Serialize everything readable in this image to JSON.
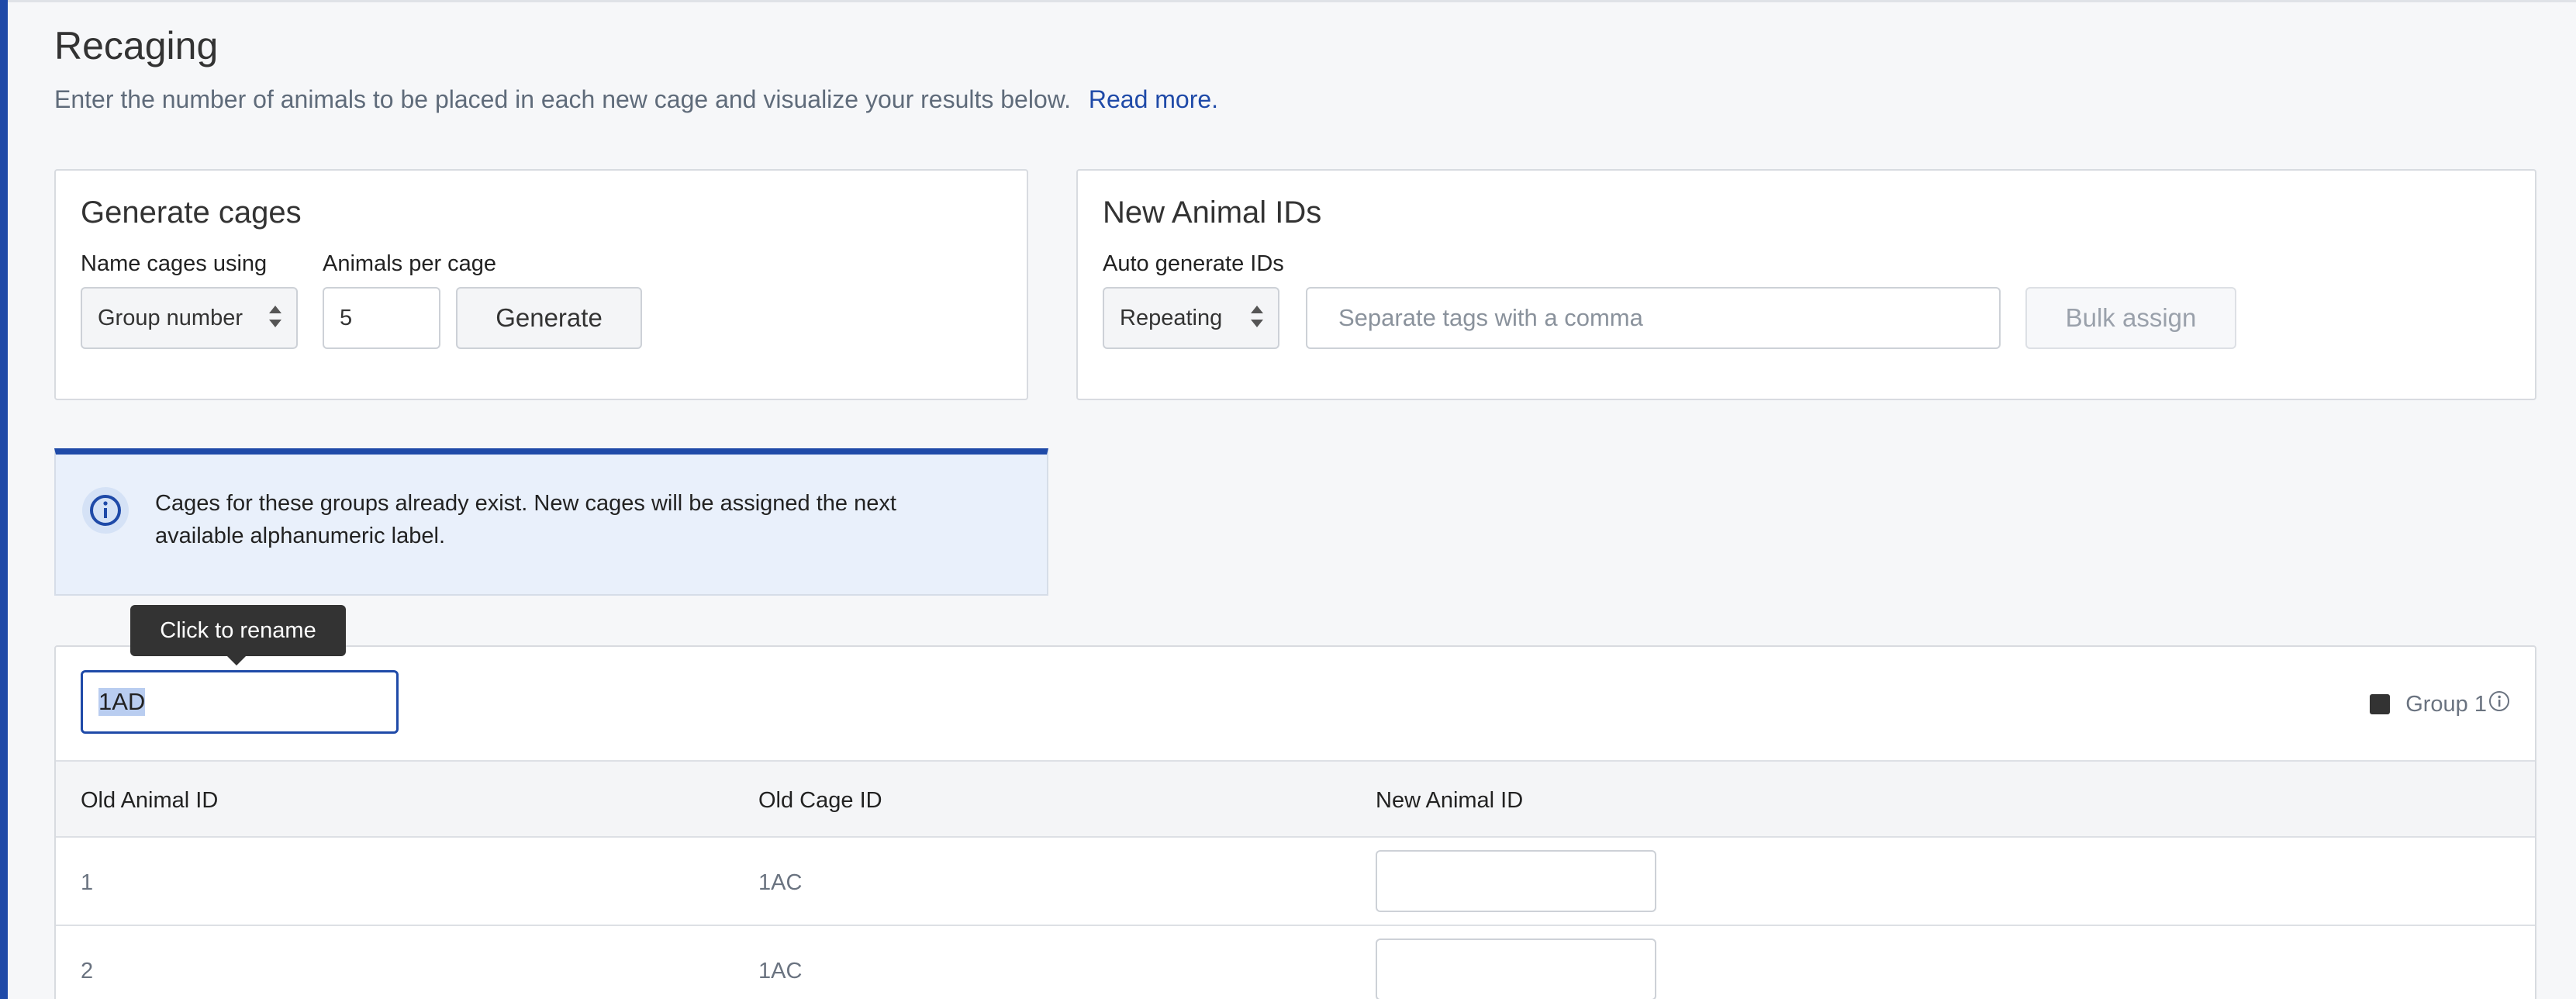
{
  "page": {
    "title": "Recaging",
    "subtitle": "Enter the number of animals to be placed in each new cage and visualize your results below.",
    "read_more": "Read more."
  },
  "generate": {
    "title": "Generate cages",
    "name_label": "Name cages using",
    "name_value": "Group number",
    "animals_label": "Animals per cage",
    "animals_value": "5",
    "button": "Generate"
  },
  "new_ids": {
    "title": "New Animal IDs",
    "auto_label": "Auto generate IDs",
    "auto_value": "Repeating",
    "tags_placeholder": "Separate tags with a comma",
    "bulk_button": "Bulk assign"
  },
  "info": {
    "text": "Cages for these groups already exist. New cages will be assigned the next available alphanumeric label."
  },
  "tooltip": {
    "text": "Click to rename"
  },
  "cage": {
    "name": "1AD",
    "group_label": "Group 1"
  },
  "table": {
    "headers": [
      "Old Animal ID",
      "Old Cage ID",
      "New Animal ID"
    ],
    "rows": [
      {
        "old_animal_id": "1",
        "old_cage_id": "1AC",
        "new_animal_id": ""
      },
      {
        "old_animal_id": "2",
        "old_cage_id": "1AC",
        "new_animal_id": ""
      }
    ]
  },
  "colors": {
    "accent": "#1f4aa8",
    "group_swatch": "#333333"
  },
  "icons": {
    "info": "info-circle-icon",
    "select": "chevron-up-down-icon"
  }
}
